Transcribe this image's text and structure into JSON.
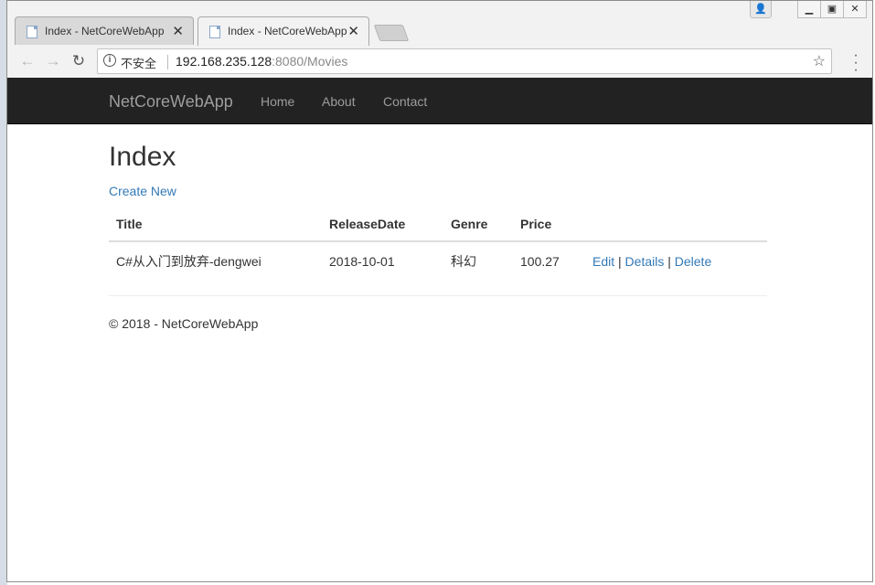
{
  "browser": {
    "tabs": [
      {
        "label": "Index - NetCoreWebApp",
        "active": false
      },
      {
        "label": "Index - NetCoreWebApp",
        "active": true
      }
    ],
    "address": {
      "security_label": "不安全",
      "host": "192.168.235.128",
      "rest": ":8080/Movies"
    }
  },
  "navbar": {
    "brand": "NetCoreWebApp",
    "links": [
      "Home",
      "About",
      "Contact"
    ]
  },
  "page": {
    "heading": "Index",
    "create_link": "Create New",
    "columns": [
      "Title",
      "ReleaseDate",
      "Genre",
      "Price"
    ],
    "rows": [
      {
        "title": "C#从入门到放弃-dengwei",
        "release_date": "2018-10-01",
        "genre": "科幻",
        "price": "100.27",
        "actions": [
          "Edit",
          "Details",
          "Delete"
        ]
      }
    ],
    "footer": "© 2018 - NetCoreWebApp"
  }
}
